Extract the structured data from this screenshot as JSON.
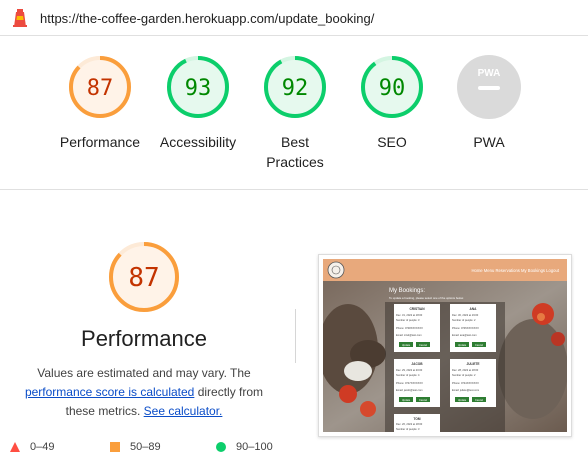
{
  "url": "https://the-coffee-garden.herokuapp.com/update_booking/",
  "colors": {
    "orange": "#fa9e3c",
    "orange_text": "#c33300",
    "green": "#0cce6b",
    "green_text": "#008800",
    "red": "#ff4e42",
    "grey": "#cccccc",
    "link": "#0b4dc8"
  },
  "gauges": [
    {
      "score": "87",
      "label": "Performance",
      "level": 0.87,
      "status": "average"
    },
    {
      "score": "93",
      "label": "Accessibility",
      "level": 0.93,
      "status": "pass"
    },
    {
      "score": "92",
      "label_line1": "Best",
      "label_line2": "Practices",
      "level": 0.92,
      "status": "pass"
    },
    {
      "score": "90",
      "label": "SEO",
      "level": 0.9,
      "status": "pass"
    },
    {
      "badge": "PWA",
      "label": "PWA",
      "status": "na"
    }
  ],
  "performance": {
    "score": "87",
    "level": 0.87,
    "title": "Performance",
    "desc_1": "Values are estimated and may vary. The",
    "link_1": "performance score is calculated",
    "desc_2": " directly from",
    "desc_3": "these metrics. ",
    "link_2": "See calculator."
  },
  "thumbnail": {
    "nav": "Home  Menu  Reservations  My Bookings  Logout",
    "heading": "My Bookings:",
    "subheading": "To update a booking, please select one of the options below.",
    "cards": [
      {
        "name": "CRISTIAN",
        "date": "Dec. 31, 2022 at 18:00",
        "guests": "Number of people: 3",
        "phone": "Phone: 0748XXXXXXX",
        "email": "Email: cristi@test.com",
        "update": "Update",
        "cancel": "Cancel"
      },
      {
        "name": "ANA",
        "date": "Dec. 30, 2022 at 19:00",
        "guests": "Number of people: 2",
        "phone": "Phone: 0745XXXXXXX",
        "email": "Email: ana@test.com",
        "update": "Update",
        "cancel": "Cancel"
      },
      {
        "name": "JACOB",
        "date": "Dec. 29, 2022 at 20:00",
        "guests": "Number of people: 4",
        "phone": "Phone: 0747XXXXXXX",
        "email": "Email: jacob@test.com",
        "update": "Update",
        "cancel": "Cancel"
      },
      {
        "name": "JULIETE",
        "date": "Dec. 28, 2022 at 18:00",
        "guests": "Number of people: 2",
        "phone": "Phone: 0744XXXXXXX",
        "email": "Email: juliete@test.com",
        "update": "Update",
        "cancel": "Cancel"
      },
      {
        "name": "TOM",
        "date": "Dec. 26, 2022 at 18:00",
        "guests": "Number of people: 3"
      }
    ]
  },
  "legend": [
    {
      "range": "0–49",
      "shape": "triangle",
      "color": "#ff4e42"
    },
    {
      "range": "50–89",
      "shape": "square",
      "color": "#fa9e3c"
    },
    {
      "range": "90–100",
      "shape": "circle",
      "color": "#0cce6b"
    }
  ]
}
